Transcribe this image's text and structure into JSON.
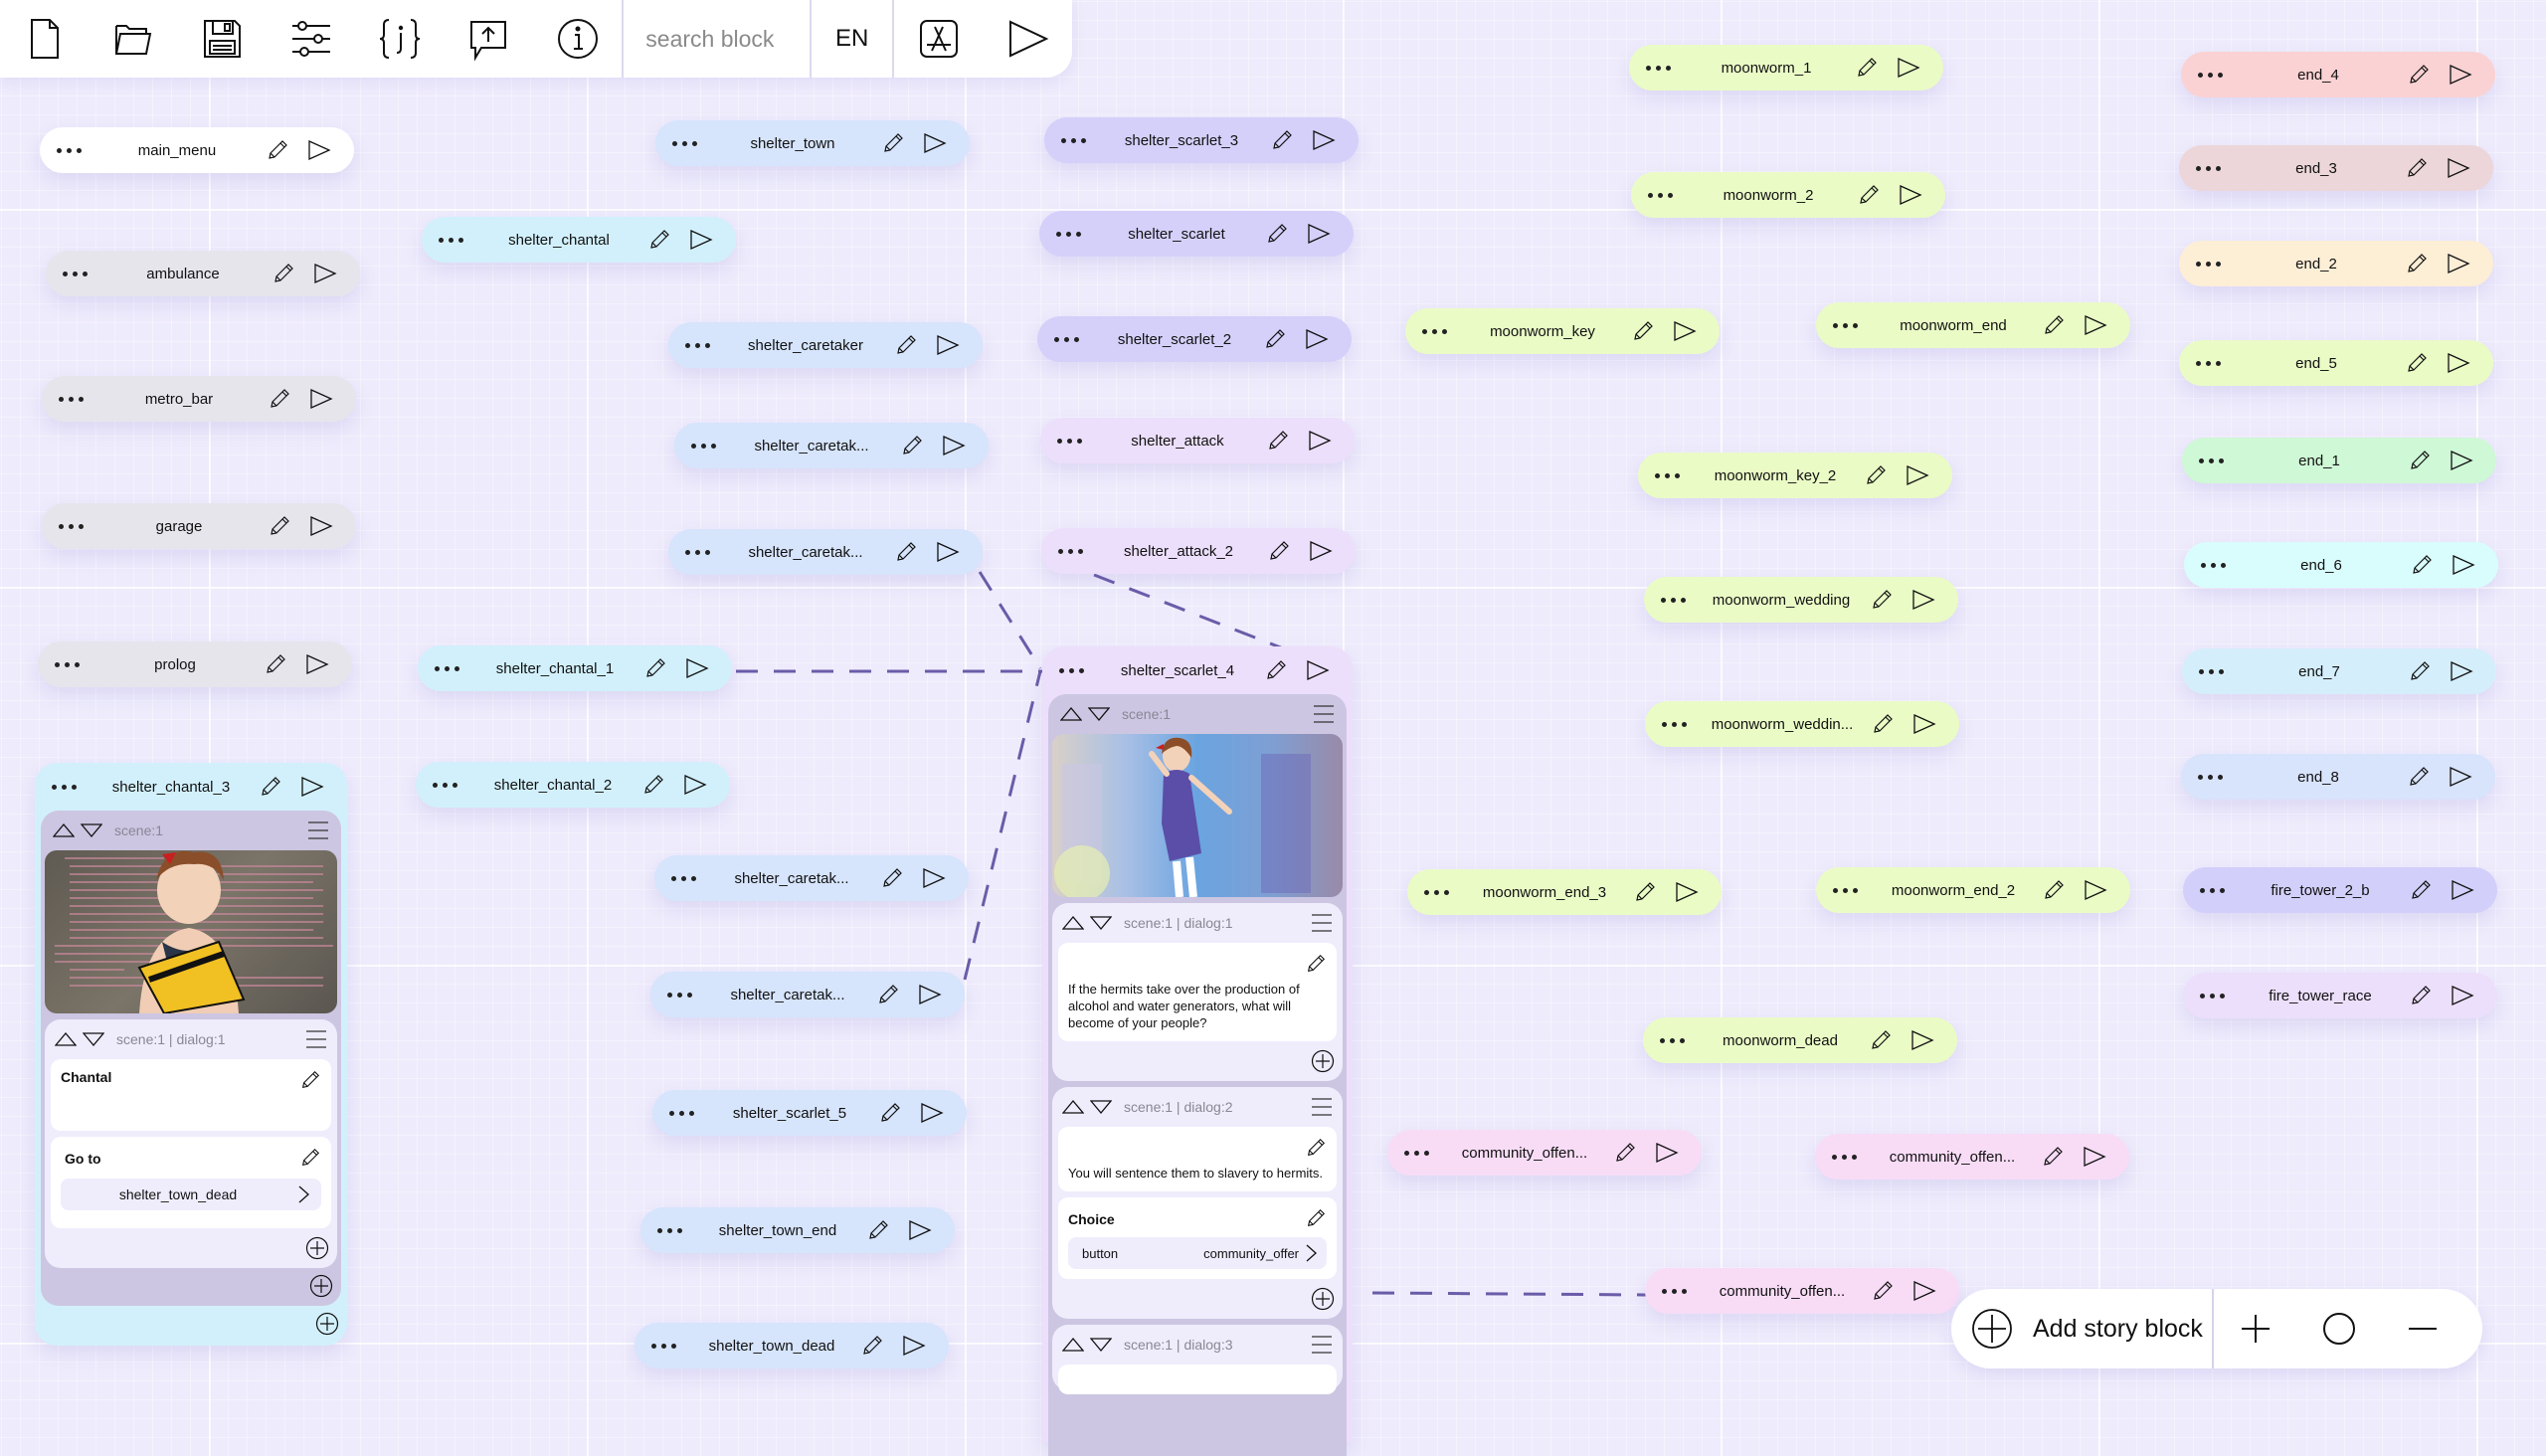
{
  "toolbar": {
    "buttons": [
      {
        "id": "new",
        "icon": "new-file-icon"
      },
      {
        "id": "open",
        "icon": "open-folder-icon"
      },
      {
        "id": "save",
        "icon": "save-icon"
      },
      {
        "id": "settings",
        "icon": "sliders-icon"
      },
      {
        "id": "json",
        "icon": "json-braces-icon"
      },
      {
        "id": "publish",
        "icon": "upload-message-icon"
      },
      {
        "id": "info",
        "icon": "info-icon"
      }
    ],
    "search_placeholder": "search block",
    "search_value": "",
    "language": "EN",
    "app_store_icon": "app-store-icon",
    "play_icon": "play-icon"
  },
  "colors": {
    "white": "#ffffff",
    "gray": "#e6e5ec",
    "cyan": "#d2f0fb",
    "blue": "#d6e4fc",
    "indigo": "#d4d0fa",
    "lavender": "#ecdffb",
    "lime": "#eafbc6",
    "pink": "#f8dcf6",
    "red": "#fbd2d4",
    "rose": "#ecd6d9",
    "peach": "#fdeed6",
    "lightgreen": "#cff8d6",
    "aqua": "#d9fdfc",
    "sky": "#d5eefb",
    "periwinkle": "#d8e3fc",
    "violet": "#d2cffa",
    "edge": "#6a5ca8"
  },
  "nodes": [
    {
      "name": "main_menu",
      "color": "white"
    },
    {
      "name": "ambulance",
      "color": "gray"
    },
    {
      "name": "metro_bar",
      "color": "gray"
    },
    {
      "name": "garage",
      "color": "gray"
    },
    {
      "name": "prolog",
      "color": "gray"
    },
    {
      "name": "shelter_chantal",
      "color": "cyan"
    },
    {
      "name": "shelter_chantal_1",
      "color": "cyan"
    },
    {
      "name": "shelter_chantal_2",
      "color": "cyan"
    },
    {
      "name": "shelter_town",
      "color": "blue"
    },
    {
      "name": "shelter_caretaker",
      "color": "blue"
    },
    {
      "name": "shelter_caretak...",
      "color": "blue"
    },
    {
      "name": "shelter_caretak...",
      "color": "blue"
    },
    {
      "name": "shelter_caretak...",
      "color": "blue"
    },
    {
      "name": "shelter_caretak...",
      "color": "blue"
    },
    {
      "name": "shelter_scarlet_5",
      "color": "blue"
    },
    {
      "name": "shelter_town_end",
      "color": "blue"
    },
    {
      "name": "shelter_town_dead",
      "color": "blue"
    },
    {
      "name": "shelter_scarlet_3",
      "color": "indigo"
    },
    {
      "name": "shelter_scarlet",
      "color": "indigo"
    },
    {
      "name": "shelter_scarlet_2",
      "color": "indigo"
    },
    {
      "name": "shelter_attack",
      "color": "lavender"
    },
    {
      "name": "shelter_attack_2",
      "color": "lavender"
    },
    {
      "name": "moonworm_1",
      "color": "lime"
    },
    {
      "name": "moonworm_2",
      "color": "lime"
    },
    {
      "name": "moonworm_key",
      "color": "lime"
    },
    {
      "name": "moonworm_end",
      "color": "lime"
    },
    {
      "name": "moonworm_key_2",
      "color": "lime"
    },
    {
      "name": "moonworm_wedding",
      "color": "lime"
    },
    {
      "name": "moonworm_weddin...",
      "color": "lime"
    },
    {
      "name": "moonworm_end_3",
      "color": "lime"
    },
    {
      "name": "moonworm_end_2",
      "color": "lime"
    },
    {
      "name": "moonworm_dead",
      "color": "lime"
    },
    {
      "name": "community_offen...",
      "color": "pink"
    },
    {
      "name": "community_offen...",
      "color": "pink"
    },
    {
      "name": "community_offen...",
      "color": "pink"
    },
    {
      "name": "end_4",
      "color": "red"
    },
    {
      "name": "end_3",
      "color": "rose"
    },
    {
      "name": "end_2",
      "color": "peach"
    },
    {
      "name": "end_5",
      "color": "lime"
    },
    {
      "name": "end_1",
      "color": "lightgreen"
    },
    {
      "name": "end_6",
      "color": "aqua"
    },
    {
      "name": "end_7",
      "color": "sky"
    },
    {
      "name": "end_8",
      "color": "periwinkle"
    },
    {
      "name": "fire_tower_2_b",
      "color": "violet"
    },
    {
      "name": "fire_tower_race",
      "color": "lavender"
    }
  ],
  "expanded": {
    "chantal3": {
      "name": "shelter_chantal_3",
      "scene_label": "scene:1",
      "image_alt": "Anime girl reading a JavaScript for Kids book in front of code",
      "dialog_label": "scene:1 | dialog:1",
      "speaker": "Chantal",
      "goto_title": "Go to",
      "goto_target": "shelter_town_dead"
    },
    "scarlet4": {
      "name": "shelter_scarlet_4",
      "scene_label": "scene:1",
      "image_alt": "Anime girl in purple dress waving in a blurred city",
      "dialog1_label": "scene:1 | dialog:1",
      "dialog1_text": "If the hermits take over the production of alcohol and water generators, what will become of your people?",
      "dialog2_label": "scene:1 | dialog:2",
      "dialog2_text": "You will sentence them to slavery to hermits.",
      "choice_title": "Choice",
      "choice_button": "button",
      "choice_target": "community_offer",
      "dialog3_label": "scene:1 | dialog:3"
    }
  },
  "bottom_bar": {
    "add_label": "Add story block",
    "zoom_in_icon": "zoom-in-icon",
    "zoom_reset_icon": "zoom-reset-icon",
    "zoom_out_icon": "zoom-out-icon"
  }
}
